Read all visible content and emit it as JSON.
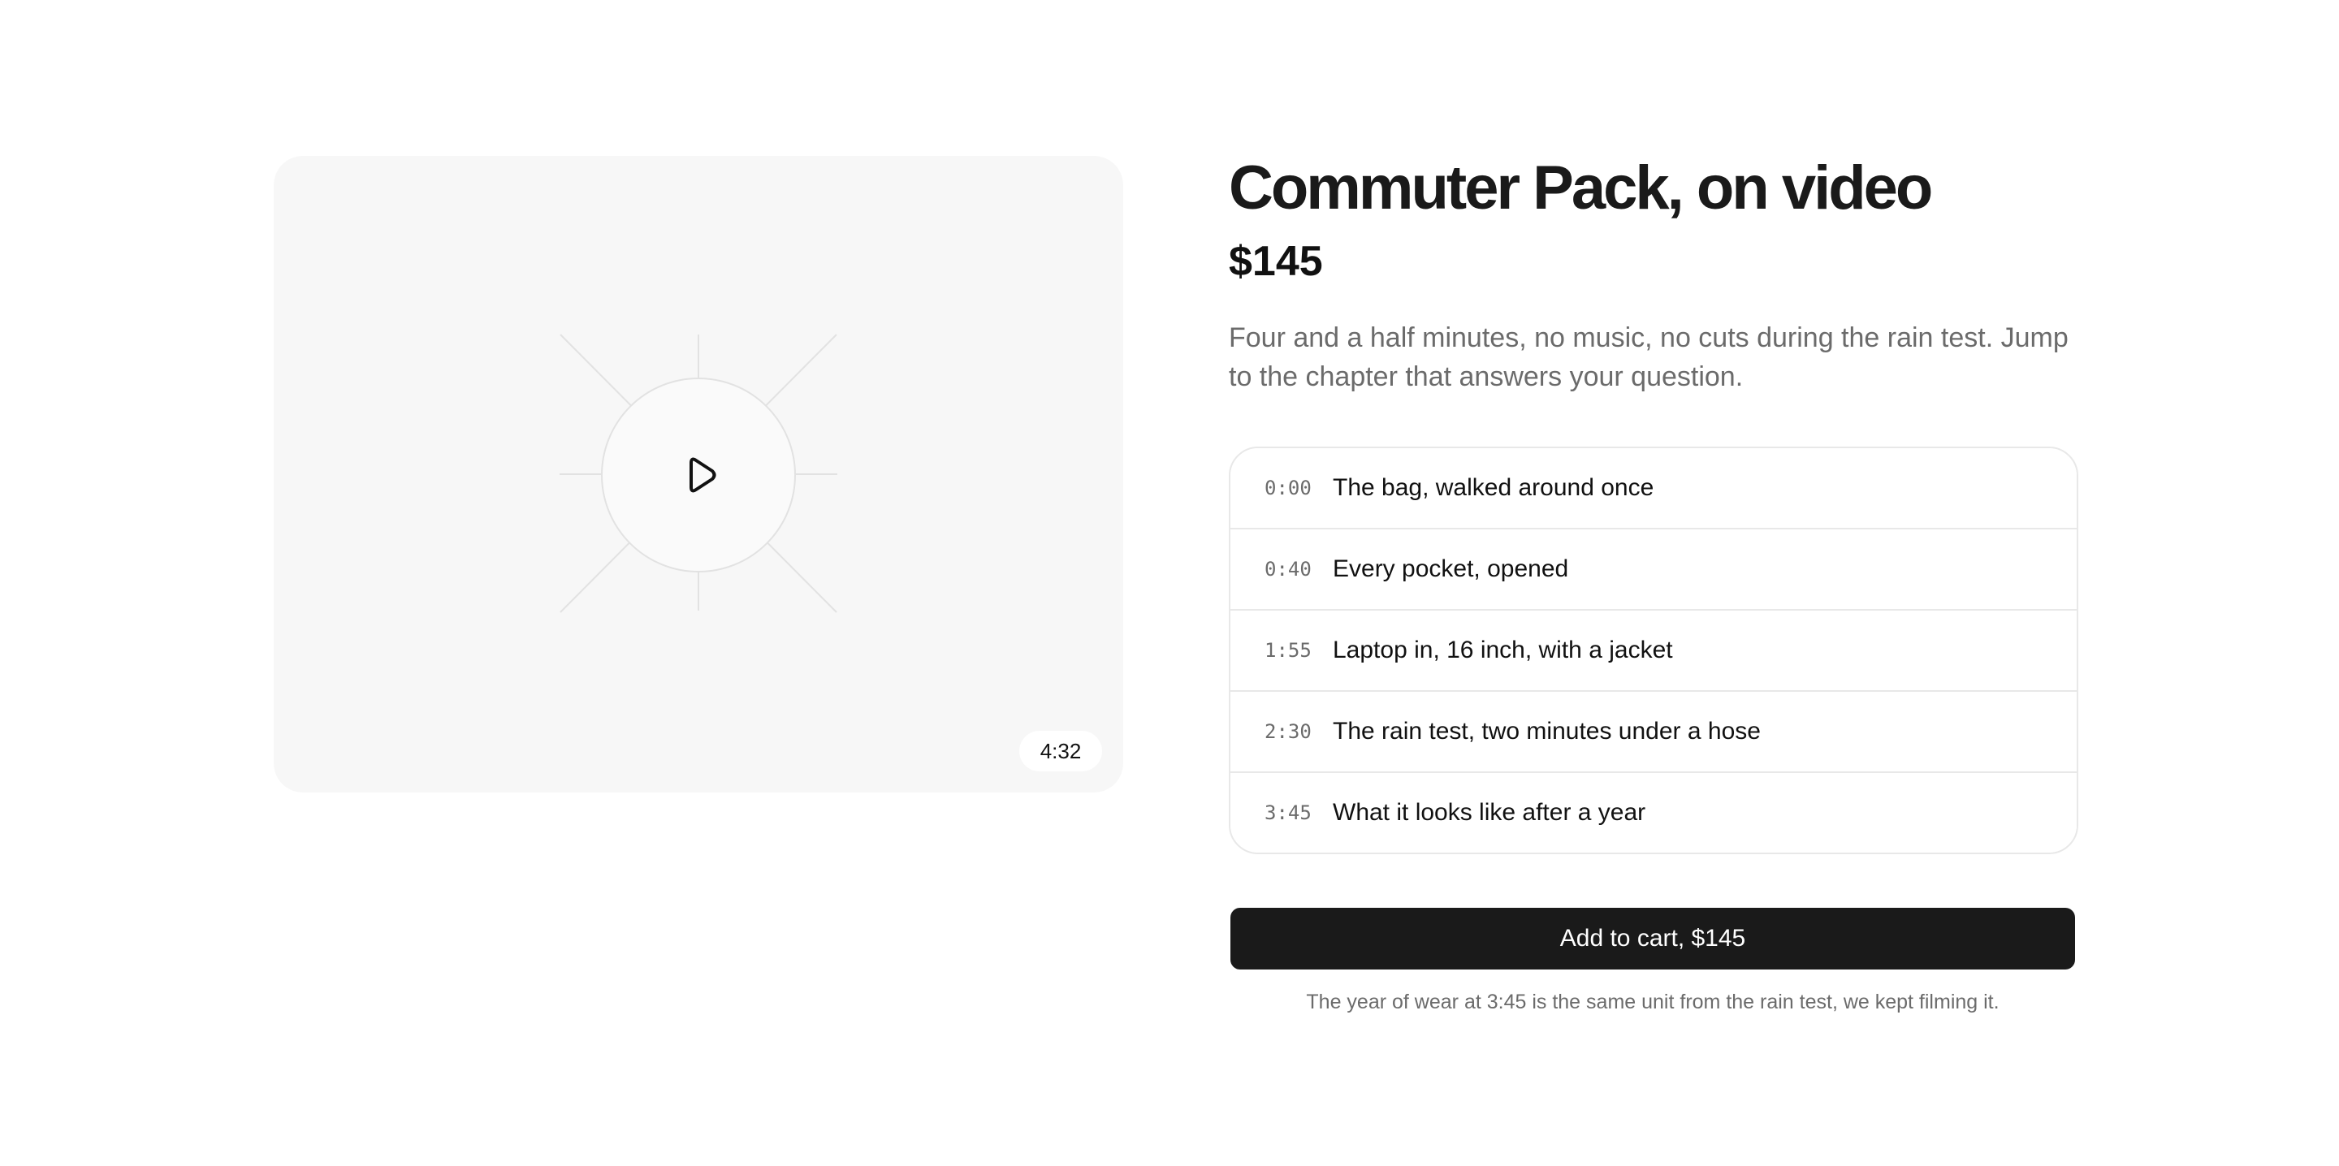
{
  "video": {
    "duration": "4:32",
    "icon": "play-icon"
  },
  "product": {
    "title": "Commuter Pack, on video",
    "price": "$145",
    "description": "Four and a half minutes, no music, no cuts during the rain test. Jump to the chapter that answers your question."
  },
  "chapters": [
    {
      "time": "0:00",
      "label": "The bag, walked around once"
    },
    {
      "time": "0:40",
      "label": "Every pocket, opened"
    },
    {
      "time": "1:55",
      "label": "Laptop in, 16 inch, with a jacket"
    },
    {
      "time": "2:30",
      "label": "The rain test, two minutes under a hose"
    },
    {
      "time": "3:45",
      "label": "What it looks like after a year"
    }
  ],
  "cart": {
    "button_label": "Add to cart, $145",
    "note": "The year of wear at 3:45 is the same unit from the rain test, we kept filming it."
  },
  "colors": {
    "button_bg": "#1a1a1a",
    "video_bg": "#f7f7f7",
    "muted_text": "#6b6b6b"
  }
}
